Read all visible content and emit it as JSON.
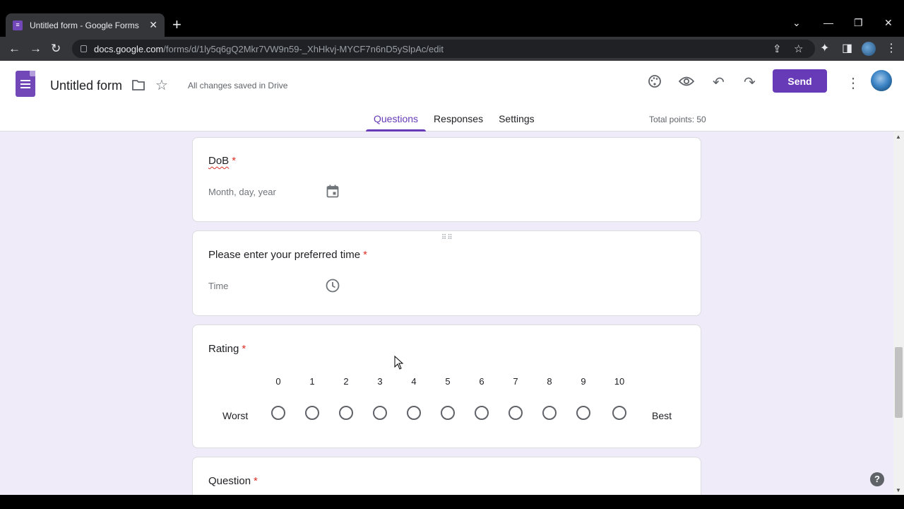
{
  "browser": {
    "tab_title": "Untitled form - Google Forms",
    "url_domain": "docs.google.com",
    "url_path": "/forms/d/1ly5q6gQ2Mkr7VW9n59-_XhHkvj-MYCF7n6nD5ySlpAc/edit"
  },
  "header": {
    "form_title": "Untitled form",
    "save_status": "All changes saved in Drive",
    "send_label": "Send",
    "tabs": [
      {
        "label": "Questions",
        "active": true
      },
      {
        "label": "Responses",
        "active": false
      },
      {
        "label": "Settings",
        "active": false
      }
    ],
    "total_points": "Total points: 50"
  },
  "questions": [
    {
      "title": "DoB",
      "required_mark": "*",
      "field_placeholder": "Month, day, year",
      "icon": "calendar-icon"
    },
    {
      "title": "Please enter your preferred time",
      "required_mark": "*",
      "field_placeholder": "Time",
      "icon": "clock-icon"
    },
    {
      "title": "Rating",
      "required_mark": "*",
      "scale": [
        "0",
        "1",
        "2",
        "3",
        "4",
        "5",
        "6",
        "7",
        "8",
        "9",
        "10"
      ],
      "low_label": "Worst",
      "high_label": "Best"
    },
    {
      "title": "Question",
      "required_mark": "*"
    }
  ],
  "help": {
    "label": "?"
  },
  "colors": {
    "accent": "#673ab7",
    "background": "#f0ebf8",
    "required": "#d93025"
  }
}
